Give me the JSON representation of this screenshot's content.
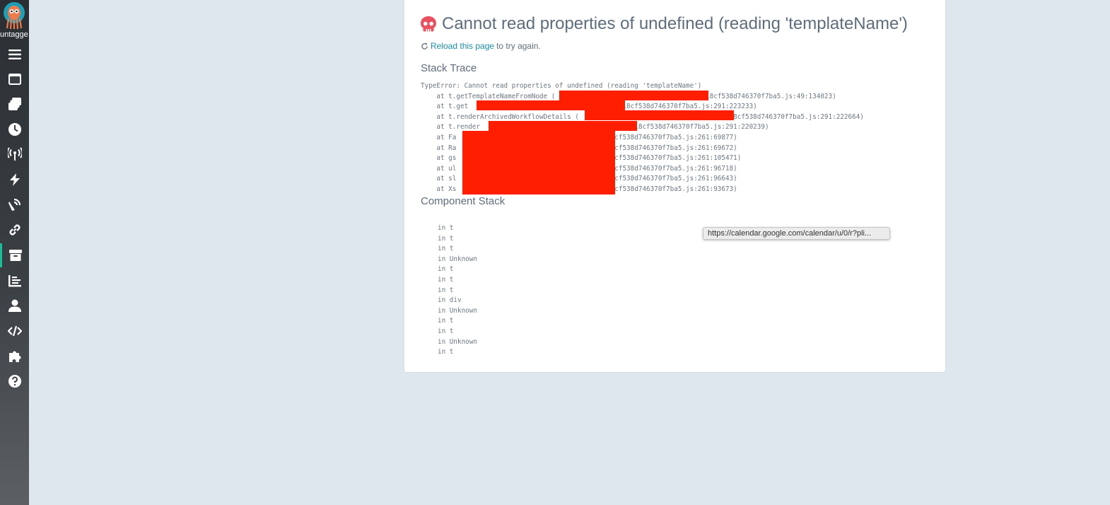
{
  "sidebar": {
    "logo_label": "untagge",
    "items": [
      {
        "icon": "menu-icon",
        "name": "nav-menu"
      },
      {
        "icon": "workflows-icon",
        "name": "nav-workflows"
      },
      {
        "icon": "workflow-templates-icon",
        "name": "nav-workflow-templates"
      },
      {
        "icon": "cron-workflows-icon",
        "name": "nav-cron-workflows"
      },
      {
        "icon": "event-sources-icon",
        "name": "nav-event-sources"
      },
      {
        "icon": "sensors-icon",
        "name": "nav-sensors"
      },
      {
        "icon": "event-flow-icon",
        "name": "nav-event-flow"
      },
      {
        "icon": "link-icon",
        "name": "nav-links"
      },
      {
        "icon": "archived-workflows-icon",
        "name": "nav-archived-workflows",
        "active": true
      },
      {
        "icon": "reports-icon",
        "name": "nav-reports"
      },
      {
        "icon": "user-icon",
        "name": "nav-user"
      },
      {
        "icon": "api-docs-icon",
        "name": "nav-api-docs"
      },
      {
        "icon": "plugins-icon",
        "name": "nav-plugins"
      },
      {
        "icon": "help-icon",
        "name": "nav-help"
      }
    ],
    "accent_color": "#18be94"
  },
  "error": {
    "title": "Cannot read properties of undefined (reading 'templateName')",
    "reload_link": "Reload this page",
    "reload_rest": "to try again.",
    "stack_heading": "Stack Trace",
    "stack_lines": [
      "TypeError: Cannot read properties of undefined (reading 'templateName')",
      "    at t.getTemplateNameFromNode (                               /main.818cf538d746370f7ba5.js:49:134023)",
      "    at t.get                               o/main.818cf538d746370f7ba5.js:291:223233)",
      "    at t.renderArchivedWorkflowDetails (                               /main.818cf538d746370f7ba5.js:291:222664)",
      "    at t.render                               o/main.818cf538d746370f7ba5.js:291:220239)",
      "    at Fa                               /main.818cf538d746370f7ba5.js:261:69877)",
      "    at Ra                               /main.818cf538d746370f7ba5.js:261:69672)",
      "    at gs                               /main.818cf538d746370f7ba5.js:261:105471)",
      "    at ul                               /main.818cf538d746370f7ba5.js:261:96718)",
      "    at sl                               /main.818cf538d746370f7ba5.js:261:96643)",
      "    at Xs                               /main.818cf538d746370f7ba5.js:261:93673)"
    ],
    "component_heading": "Component Stack",
    "component_lines": [
      "in t",
      "in t",
      "in t",
      "in Unknown",
      "in t",
      "in t",
      "in t",
      "in div",
      "in Unknown",
      "in t",
      "in t",
      "in Unknown",
      "in t"
    ],
    "error_color": "#e8515f",
    "redaction_color": "#ff1e00"
  },
  "tooltip": {
    "text": "https://calendar.google.com/calendar/u/0/r?pli..."
  }
}
